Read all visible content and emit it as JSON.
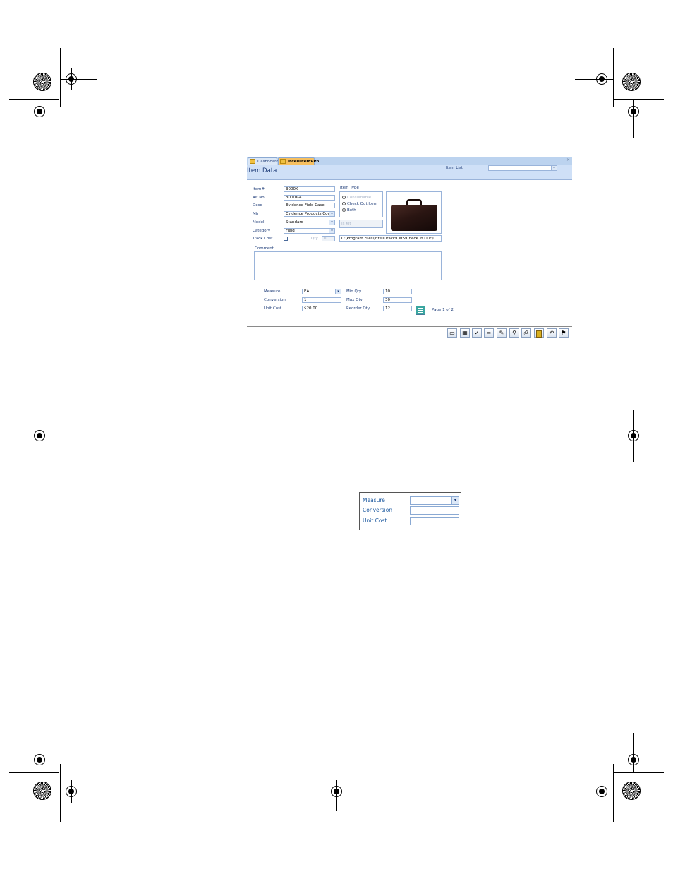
{
  "tabs": [
    {
      "label": "Dashboard",
      "active": false
    },
    {
      "label": "IntelliItemVPn",
      "active": true
    }
  ],
  "close_glyph": "×",
  "header": {
    "title": "Item Data",
    "item_list_label": "Item List",
    "item_list_value": ""
  },
  "fields": {
    "item_no": {
      "label": "Item#",
      "value": "3000K"
    },
    "alt_no": {
      "label": "Alt No.",
      "value": "3000K-A"
    },
    "desc": {
      "label": "Desc",
      "value": "Evidence Field Case"
    },
    "mfr": {
      "label": "Mfr",
      "value": "Evidence Products Corp"
    },
    "model": {
      "label": "Model",
      "value": "Standard"
    },
    "category": {
      "label": "Category",
      "value": "Field"
    },
    "track_cost": {
      "label": "Track Cost",
      "checked": false
    },
    "qty": {
      "label": "Qty",
      "value": "0"
    }
  },
  "item_type": {
    "label": "Item Type",
    "options": [
      {
        "label": "Consumable",
        "selected": false,
        "disabled": true
      },
      {
        "label": "Check Out Item",
        "selected": true,
        "disabled": false
      },
      {
        "label": "Both",
        "selected": false,
        "disabled": false
      }
    ],
    "kit_label": "Is Kit"
  },
  "image_path": "C:\\Program Files\\IntelliTrack\\CMS\\Check In Out\\I...",
  "comment": {
    "label": "Comment",
    "value": ""
  },
  "measure": {
    "measure": {
      "label": "Measure",
      "value": "EA"
    },
    "conversion": {
      "label": "Conversion",
      "value": "1"
    },
    "unit_cost": {
      "label": "Unit Cost",
      "value": "$20.00"
    },
    "min_qty": {
      "label": "Min Qty",
      "value": "10"
    },
    "max_qty": {
      "label": "Max Qty",
      "value": "30"
    },
    "reorder_qty": {
      "label": "Reorder Qty",
      "value": "12"
    }
  },
  "page_indicator": "Page 1 of 2",
  "toolbar_icons": {
    "new": "new-record-icon",
    "calculator": "calculator-icon",
    "check": "✓",
    "next": "➡",
    "edit": "edit-icon",
    "find": "magnifier-icon",
    "print": "print-icon",
    "delete": "trash-icon",
    "undo": "↶",
    "exit": "exit-icon"
  },
  "zoom_panel": {
    "measure_label": "Measure",
    "conversion_label": "Conversion",
    "unit_cost_label": "Unit Cost"
  },
  "colors": {
    "header_bg": "#cfe0f7",
    "label_text": "#1e3c78",
    "active_tab": "#f7c060"
  }
}
